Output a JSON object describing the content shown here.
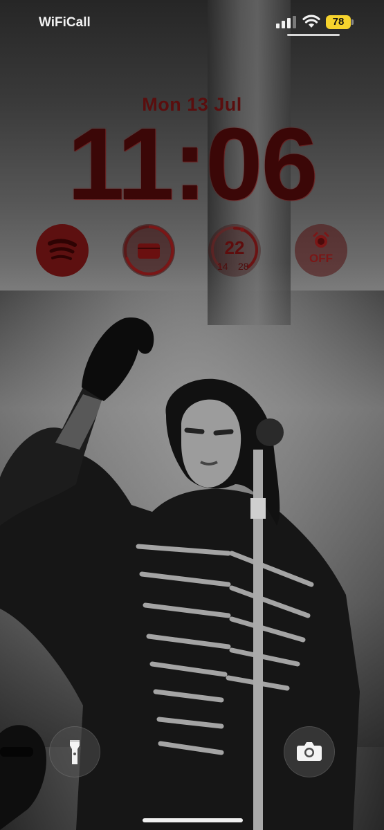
{
  "status_bar": {
    "carrier": "WiFiCall",
    "battery_level": "78",
    "battery_color": "#f6d32d",
    "signal_bars": 3,
    "icons": [
      "cellular-signal-icon",
      "wifi-icon",
      "battery-icon"
    ]
  },
  "lock_screen": {
    "date": "Mon 13 Jul",
    "time": "11:06",
    "accent_color": "#5a0e0e"
  },
  "widgets": {
    "spotify": {
      "icon": "spotify-icon"
    },
    "wallet": {
      "icon": "wallet-icon"
    },
    "weather": {
      "current": "22",
      "low": "14",
      "high": "28"
    },
    "alarm": {
      "icon": "alarm-clock-icon",
      "status": "OFF"
    }
  },
  "controls": {
    "flashlight": {
      "icon": "flashlight-icon"
    },
    "camera": {
      "icon": "camera-icon"
    }
  }
}
